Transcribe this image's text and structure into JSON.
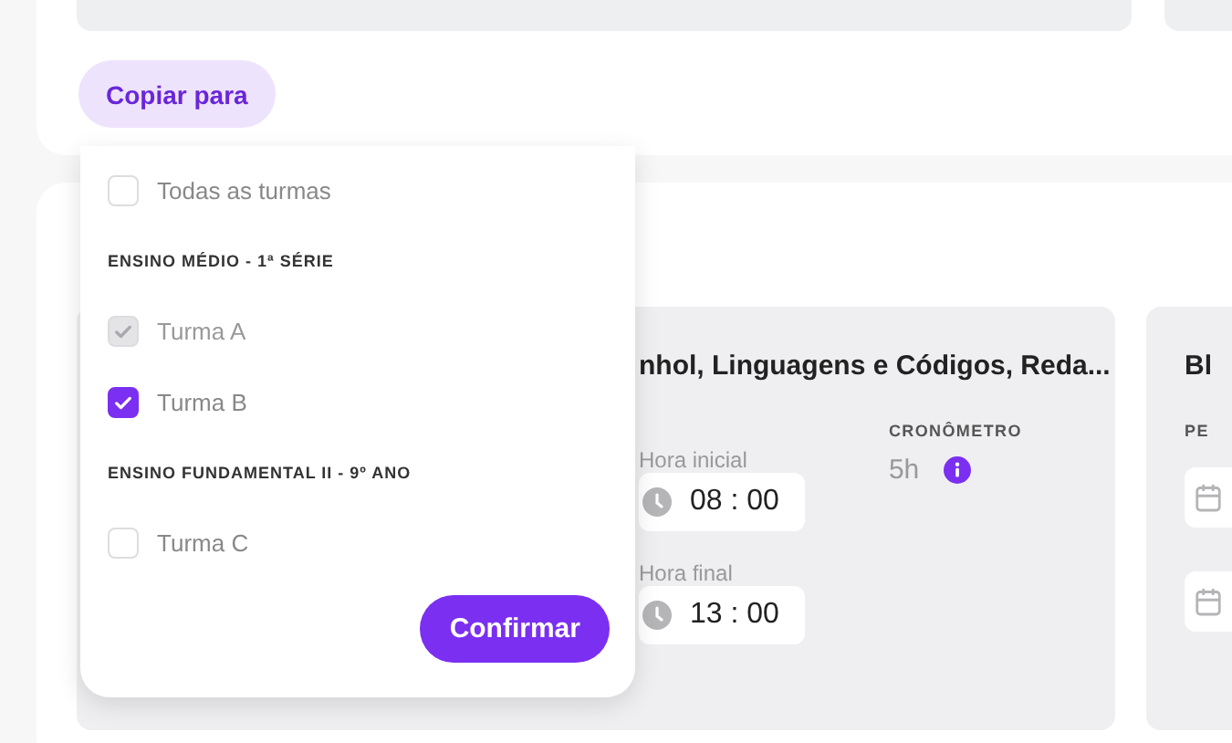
{
  "top_card": {
    "copy_button": "Copiar para"
  },
  "copy_menu": {
    "all_option": {
      "label": "Todas as turmas",
      "checked": false,
      "disabled": false
    },
    "groups": [
      {
        "title": "ENSINO MÉDIO - 1ª SÉRIE",
        "options": [
          {
            "label": "Turma A",
            "checked": true,
            "disabled": true
          },
          {
            "label": "Turma B",
            "checked": true,
            "disabled": false
          }
        ]
      },
      {
        "title": "ENSINO FUNDAMENTAL II - 9º ANO",
        "options": [
          {
            "label": "Turma C",
            "checked": false,
            "disabled": false
          }
        ]
      }
    ],
    "confirm_button": "Confirmar"
  },
  "schedule_card": {
    "title": "nhol, Linguagens e Códigos, Reda...",
    "start_label": "Hora inicial",
    "start_time": "08 : 00",
    "end_label": "Hora final",
    "end_time": "13 : 00",
    "timer_label": "CRONÔMETRO",
    "timer_value": "5h"
  },
  "next_card": {
    "title": "Bl",
    "label": "PE"
  }
}
